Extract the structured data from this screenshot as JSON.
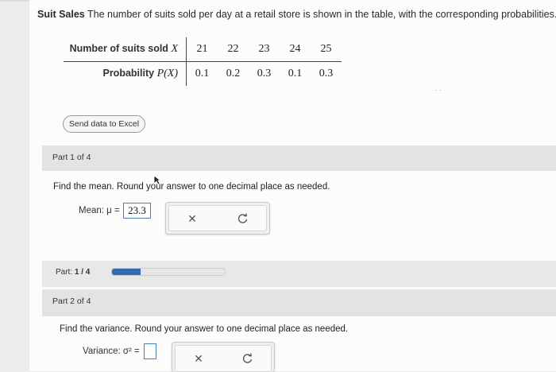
{
  "problem": {
    "title": "Suit Sales",
    "text": "The number of suits sold per day at a retail store is shown in the table, with the corresponding probabilities."
  },
  "table": {
    "row1_label": "Number of suits sold",
    "row1_var": "X",
    "row2_label": "Probability",
    "row2_var": "P(X)",
    "x_values": [
      "21",
      "22",
      "23",
      "24",
      "25"
    ],
    "p_values": [
      "0.1",
      "0.2",
      "0.3",
      "0.1",
      "0.3"
    ]
  },
  "excel_button": "Send data to Excel",
  "part1": {
    "header": "Part 1 of 4",
    "question": "Find the mean. Round your answer to one decimal place as needed.",
    "label": "Mean: μ =",
    "answer": "23.3"
  },
  "progress": {
    "label_prefix": "Part:",
    "label_value": "1 / 4",
    "fraction": 0.25
  },
  "part2": {
    "header": "Part 2 of 4",
    "question": "Find the variance. Round your answer to one decimal place as needed.",
    "label": "Variance: σ² =",
    "answer": ""
  },
  "icons": {
    "clear": "close-icon",
    "redo": "redo-icon",
    "accent_color": "#2f6cb3"
  }
}
